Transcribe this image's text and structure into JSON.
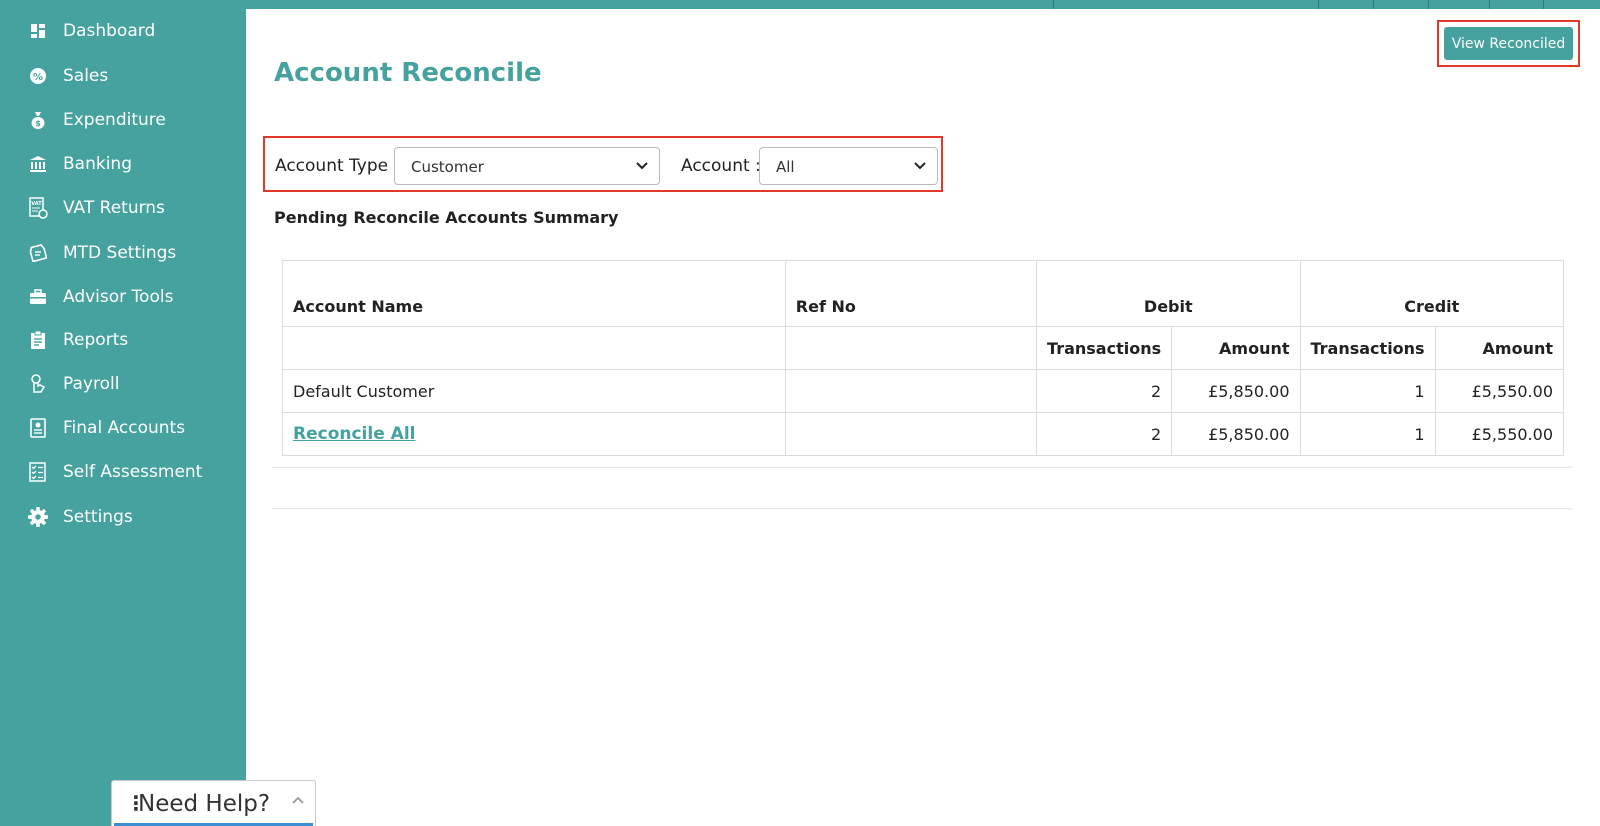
{
  "sidebar": {
    "items": [
      {
        "label": "Dashboard",
        "icon": "dashboard-icon"
      },
      {
        "label": "Sales",
        "icon": "sales-icon"
      },
      {
        "label": "Expenditure",
        "icon": "money-bag-icon"
      },
      {
        "label": "Banking",
        "icon": "bank-icon"
      },
      {
        "label": "VAT Returns",
        "icon": "vat-icon"
      },
      {
        "label": "MTD Settings",
        "icon": "mtd-icon"
      },
      {
        "label": "Advisor Tools",
        "icon": "briefcase-icon"
      },
      {
        "label": "Reports",
        "icon": "report-icon"
      },
      {
        "label": "Payroll",
        "icon": "payroll-icon"
      },
      {
        "label": "Final Accounts",
        "icon": "final-accounts-icon"
      },
      {
        "label": "Self Assessment",
        "icon": "checklist-icon"
      },
      {
        "label": "Settings",
        "icon": "gear-icon"
      }
    ]
  },
  "page": {
    "title": "Account Reconcile",
    "view_button": "View Reconciled",
    "filters": {
      "account_type_label": "Account Type :",
      "account_type_value": "Customer",
      "account_label": "Account :",
      "account_value": "All"
    },
    "summary_heading": "Pending Reconcile Accounts Summary"
  },
  "table": {
    "headers": {
      "account_name": "Account Name",
      "ref_no": "Ref No",
      "debit": "Debit",
      "credit": "Credit",
      "transactions": "Transactions",
      "amount": "Amount"
    },
    "rows": [
      {
        "name": "Default Customer",
        "ref": "",
        "debit_tx": "2",
        "debit_amt": "£5,850.00",
        "credit_tx": "1",
        "credit_amt": "£5,550.00"
      }
    ],
    "total": {
      "label": "Reconcile All",
      "debit_tx": "2",
      "debit_amt": "£5,850.00",
      "credit_tx": "1",
      "credit_amt": "£5,550.00"
    }
  },
  "help": {
    "label": "Need Help?"
  },
  "colors": {
    "accent": "#45a29e",
    "highlight": "#e03a2a"
  }
}
